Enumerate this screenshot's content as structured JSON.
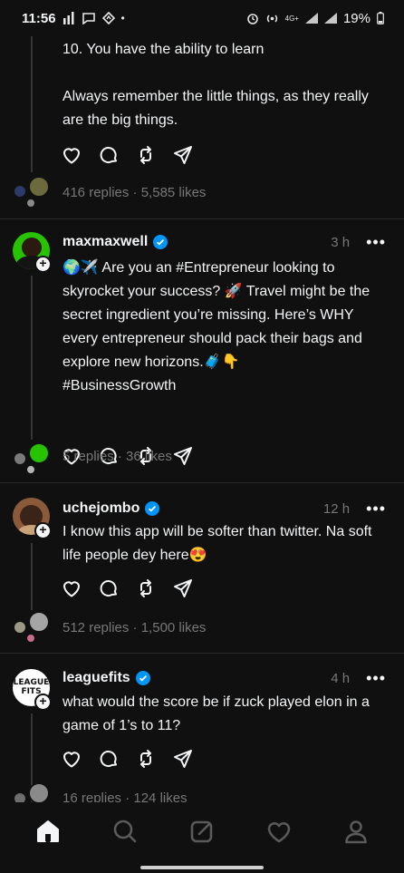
{
  "status": {
    "time": "11:56",
    "left_icons": [
      "signal-bars-icon",
      "chat-icon",
      "navigation-icon"
    ],
    "dot": "•",
    "network": "4G+",
    "battery": "19%"
  },
  "posts": [
    {
      "text": "10. You have the ability to learn\n\nAlways remember the little things, as they really are the big things.",
      "stats": "416 replies · 5,585 likes"
    },
    {
      "username": "maxmaxwell",
      "verified": true,
      "time": "3 h",
      "text": "🌍✈️ Are you an #Entrepreneur looking to skyrocket your success? 🚀 Travel might be the secret ingredient you’re missing. Here’s WHY every entrepreneur should pack their bags and explore new horizons.🧳👇\n#BusinessGrowth",
      "stats": "5 replies · 36 likes"
    },
    {
      "username": "uchejombo",
      "verified": true,
      "time": "12 h",
      "text": "I know this app will be softer than twitter. Na soft life people dey here😍",
      "stats": "512 replies · 1,500 likes"
    },
    {
      "username": "leaguefits",
      "verified": true,
      "time": "4 h",
      "avatar_text": "LEAGUE FITS",
      "text": "what would the score be if zuck played elon in a game of 1’s to 11?",
      "stats": "16 replies · 124 likes"
    }
  ],
  "more_label": "•••",
  "plus_label": "+",
  "nav": [
    "home-icon",
    "search-icon",
    "compose-icon",
    "activity-heart-icon",
    "profile-icon"
  ],
  "colors": {
    "background": "#101010",
    "text": "#f3f5f7",
    "muted": "#777777",
    "verified": "#0095f6",
    "divider": "#2a2a2a"
  }
}
